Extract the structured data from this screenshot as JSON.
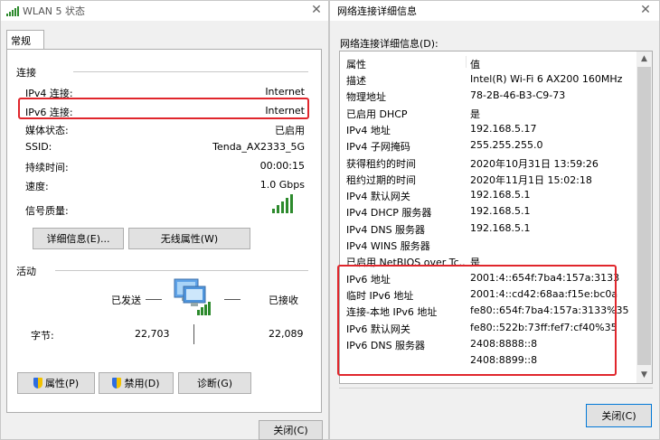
{
  "left_window": {
    "title": "WLAN 5 状态",
    "tab_general": "常规",
    "connection": {
      "header": "连接",
      "rows": [
        {
          "label": "IPv4 连接:",
          "value": "Internet"
        },
        {
          "label": "IPv6 连接:",
          "value": "Internet"
        },
        {
          "label": "媒体状态:",
          "value": "已启用"
        },
        {
          "label": "SSID:",
          "value": "Tenda_AX2333_5G"
        },
        {
          "label": "持续时间:",
          "value": "00:00:15"
        },
        {
          "label": "速度:",
          "value": "1.0 Gbps"
        }
      ],
      "signal_label": "信号质量:",
      "details_button": "详细信息(E)...",
      "wireless_props_button": "无线属性(W)"
    },
    "activity": {
      "header": "活动",
      "sent_label": "已发送",
      "received_label": "已接收",
      "bytes_label": "字节:",
      "bytes_sent": "22,703",
      "bytes_received": "22,089"
    },
    "buttons": {
      "properties": "属性(P)",
      "disable": "禁用(D)",
      "diagnose": "诊断(G)",
      "close": "关闭(C)"
    }
  },
  "right_window": {
    "title": "网络连接详细信息",
    "list_label": "网络连接详细信息(D):",
    "columns": [
      "属性",
      "值"
    ],
    "rows": [
      [
        "描述",
        "Intel(R) Wi-Fi 6 AX200 160MHz"
      ],
      [
        "物理地址",
        "78-2B-46-B3-C9-73"
      ],
      [
        "已启用 DHCP",
        "是"
      ],
      [
        "IPv4 地址",
        "192.168.5.17"
      ],
      [
        "IPv4 子网掩码",
        "255.255.255.0"
      ],
      [
        "获得租约的时间",
        "2020年10月31日 13:59:26"
      ],
      [
        "租约过期的时间",
        "2020年11月1日 15:02:18"
      ],
      [
        "IPv4 默认网关",
        "192.168.5.1"
      ],
      [
        "IPv4 DHCP 服务器",
        "192.168.5.1"
      ],
      [
        "IPv4 DNS 服务器",
        "192.168.5.1"
      ],
      [
        "IPv4 WINS 服务器",
        ""
      ],
      [
        "已启用 NetBIOS over Tc...",
        "是"
      ],
      [
        "IPv6 地址",
        "2001:4::654f:7ba4:157a:3133"
      ],
      [
        "临时 IPv6 地址",
        "2001:4::cd42:68aa:f15e:bc0a"
      ],
      [
        "连接-本地 IPv6 地址",
        "fe80::654f:7ba4:157a:3133%35"
      ],
      [
        "IPv6 默认网关",
        "fe80::522b:73ff:fef7:cf40%35"
      ],
      [
        "IPv6 DNS 服务器",
        "2408:8888::8"
      ],
      [
        "",
        "2408:8899::8"
      ]
    ],
    "close_button": "关闭(C)"
  },
  "colors": {
    "highlight": "#e0262c",
    "signal_green": "#2d8a2d"
  }
}
